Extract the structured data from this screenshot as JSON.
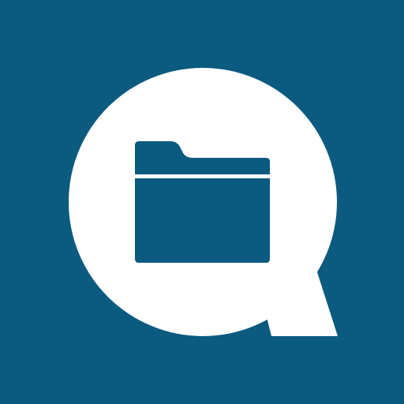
{
  "app_icon": {
    "icon_name": "search-folder-icon",
    "colors": {
      "background": "#0b5a80",
      "speech_bubble": "#ffffff",
      "folder": "#0b5a80"
    }
  }
}
